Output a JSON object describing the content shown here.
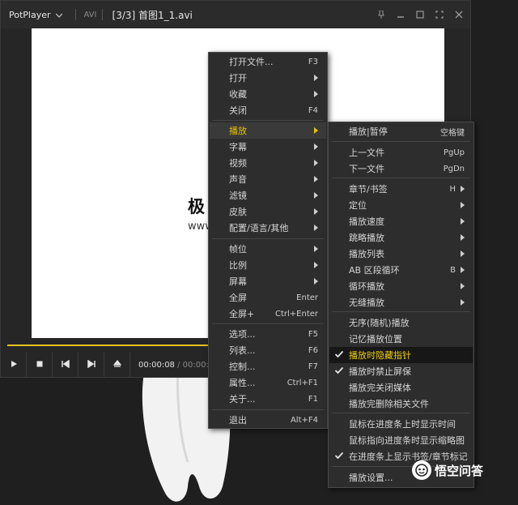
{
  "window": {
    "app_name": "PotPlayer",
    "format": "AVI",
    "title": "[3/3] 首图1_1.avi"
  },
  "video": {
    "big_text": "极",
    "small_text": "www"
  },
  "playback": {
    "current_time": "00:00:08",
    "total_time": "/ 00:00:0",
    "progress_fraction": 0.5
  },
  "main_menu": [
    {
      "label": "打开文件...",
      "shortcut": "F3",
      "arrow": false
    },
    {
      "label": "打开",
      "shortcut": "",
      "arrow": true
    },
    {
      "label": "收藏",
      "shortcut": "",
      "arrow": true
    },
    {
      "label": "关闭",
      "shortcut": "F4",
      "arrow": false
    },
    {
      "label": "播放",
      "shortcut": "",
      "arrow": true,
      "active": true
    },
    {
      "label": "字幕",
      "shortcut": "",
      "arrow": true
    },
    {
      "label": "视频",
      "shortcut": "",
      "arrow": true
    },
    {
      "label": "声音",
      "shortcut": "",
      "arrow": true
    },
    {
      "label": "滤镜",
      "shortcut": "",
      "arrow": true
    },
    {
      "label": "皮肤",
      "shortcut": "",
      "arrow": true
    },
    {
      "label": "配置/语言/其他",
      "shortcut": "",
      "arrow": true
    },
    {
      "label": "帧位",
      "shortcut": "",
      "arrow": true
    },
    {
      "label": "比例",
      "shortcut": "",
      "arrow": true
    },
    {
      "label": "屏幕",
      "shortcut": "",
      "arrow": true
    },
    {
      "label": "全屏",
      "shortcut": "Enter",
      "arrow": false
    },
    {
      "label": "全屏+",
      "shortcut": "Ctrl+Enter",
      "arrow": false
    },
    {
      "label": "选项...",
      "shortcut": "F5",
      "arrow": false
    },
    {
      "label": "列表...",
      "shortcut": "F6",
      "arrow": false
    },
    {
      "label": "控制...",
      "shortcut": "F7",
      "arrow": false
    },
    {
      "label": "属性...",
      "shortcut": "Ctrl+F1",
      "arrow": false
    },
    {
      "label": "关于...",
      "shortcut": "F1",
      "arrow": false
    },
    {
      "label": "退出",
      "shortcut": "Alt+F4",
      "arrow": false
    }
  ],
  "play_submenu": [
    {
      "label": "播放|暂停",
      "shortcut": "空格键"
    },
    {
      "label": "上一文件",
      "shortcut": "PgUp"
    },
    {
      "label": "下一文件",
      "shortcut": "PgDn"
    },
    {
      "label": "章节/书签",
      "shortcut": "H",
      "arrow": true
    },
    {
      "label": "定位",
      "shortcut": "",
      "arrow": true
    },
    {
      "label": "播放速度",
      "shortcut": "",
      "arrow": true
    },
    {
      "label": "跳略播放",
      "shortcut": "",
      "arrow": true
    },
    {
      "label": "播放列表",
      "shortcut": "",
      "arrow": true
    },
    {
      "label": "AB 区段循环",
      "shortcut": "B",
      "arrow": true
    },
    {
      "label": "循环播放",
      "shortcut": "",
      "arrow": true
    },
    {
      "label": "无缝播放",
      "shortcut": "",
      "arrow": true
    },
    {
      "label": "无序(随机)播放",
      "shortcut": ""
    },
    {
      "label": "记忆播放位置",
      "shortcut": ""
    },
    {
      "label": "播放时隐藏指针",
      "shortcut": "",
      "checked": true,
      "highlighted": true
    },
    {
      "label": "播放时禁止屏保",
      "shortcut": "",
      "checked": true
    },
    {
      "label": "播放完关闭媒体",
      "shortcut": ""
    },
    {
      "label": "播放完删除相关文件",
      "shortcut": ""
    },
    {
      "label": "鼠标在进度条上时显示时间",
      "shortcut": ""
    },
    {
      "label": "鼠标指向进度条时显示缩略图",
      "shortcut": ""
    },
    {
      "label": "在进度条上显示书签/章节标记",
      "shortcut": "",
      "checked": true
    },
    {
      "label": "播放设置...",
      "shortcut": ""
    }
  ],
  "watermark": {
    "text": "悟空问答"
  },
  "colors": {
    "accent": "#e8c400",
    "menu_bg": "#2d2d2d",
    "titlebar_bg": "#2b2b2b"
  }
}
